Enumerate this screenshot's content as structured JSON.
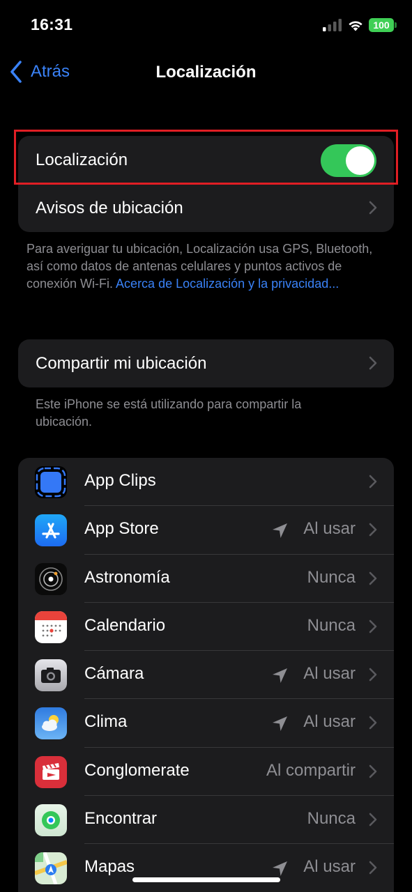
{
  "status_bar": {
    "time": "16:31",
    "battery": "100"
  },
  "nav": {
    "back_label": "Atrás",
    "title": "Localización"
  },
  "location_group": {
    "toggle_label": "Localización",
    "toggle_on": true,
    "alerts_label": "Avisos de ubicación"
  },
  "location_footnote": {
    "text": "Para averiguar tu ubicación, Localización usa GPS, Bluetooth, así como datos de antenas celulares y puntos activos de conexión Wi-Fi.",
    "link": "Acerca de Localización y la privacidad..."
  },
  "share_group": {
    "label": "Compartir mi ubicación"
  },
  "share_footnote": "Este iPhone se está utilizando para compartir la ubicación.",
  "apps": [
    {
      "name": "App Clips",
      "value": "",
      "arrow": false,
      "icon": "app-clips-icon"
    },
    {
      "name": "App Store",
      "value": "Al usar",
      "arrow": true,
      "icon": "app-store-icon"
    },
    {
      "name": "Astronomía",
      "value": "Nunca",
      "arrow": false,
      "icon": "astronomy-icon"
    },
    {
      "name": "Calendario",
      "value": "Nunca",
      "arrow": false,
      "icon": "calendar-icon"
    },
    {
      "name": "Cámara",
      "value": "Al usar",
      "arrow": true,
      "icon": "camera-icon"
    },
    {
      "name": "Clima",
      "value": "Al usar",
      "arrow": true,
      "icon": "weather-icon"
    },
    {
      "name": "Conglomerate",
      "value": "Al compartir",
      "arrow": false,
      "icon": "conglomerate-icon"
    },
    {
      "name": "Encontrar",
      "value": "Nunca",
      "arrow": false,
      "icon": "find-my-icon"
    },
    {
      "name": "Mapas",
      "value": "Al usar",
      "arrow": true,
      "icon": "maps-icon"
    }
  ],
  "colors": {
    "accent": "#3a82f7",
    "toggle_on": "#34c759",
    "highlight": "#e01e24",
    "cell": "#1c1c1e",
    "secondary_text": "#8e8e93"
  }
}
